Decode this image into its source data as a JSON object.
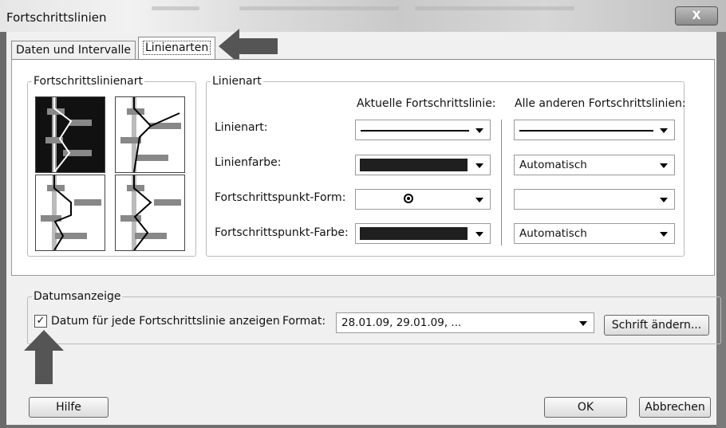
{
  "window": {
    "title": "Fortschrittslinien",
    "close_symbol": "X"
  },
  "tabs": [
    {
      "label": "Daten und Intervalle"
    },
    {
      "label": "Linienarten"
    }
  ],
  "style_group": {
    "label": "Fortschrittslinienart"
  },
  "line_group": {
    "label": "Linienart",
    "col_current": "Aktuelle Fortschrittslinie:",
    "col_others": "Alle anderen Fortschrittslinien:",
    "rows": [
      {
        "label": "Linienart:",
        "current": "",
        "others": ""
      },
      {
        "label": "Linienfarbe:",
        "current": "",
        "others": "Automatisch"
      },
      {
        "label": "Fortschrittspunkt-Form:",
        "current": "",
        "others": ""
      },
      {
        "label": "Fortschrittspunkt-Farbe:",
        "current": "",
        "others": "Automatisch"
      }
    ]
  },
  "date_group": {
    "label": "Datumsanzeige",
    "checkbox_label": "Datum für jede Fortschrittslinie anzeigen",
    "checkbox_checked": true,
    "checkbox_mark": "✓",
    "format_label": "Format:",
    "format_value": "28.01.09, 29.01.09, ...",
    "font_button": "Schrift ändern..."
  },
  "buttons": {
    "help": "Hilfe",
    "ok": "OK",
    "cancel": "Abbrechen"
  },
  "colors": {
    "swatch": "#1f1f1f",
    "arrow": "#555555"
  }
}
